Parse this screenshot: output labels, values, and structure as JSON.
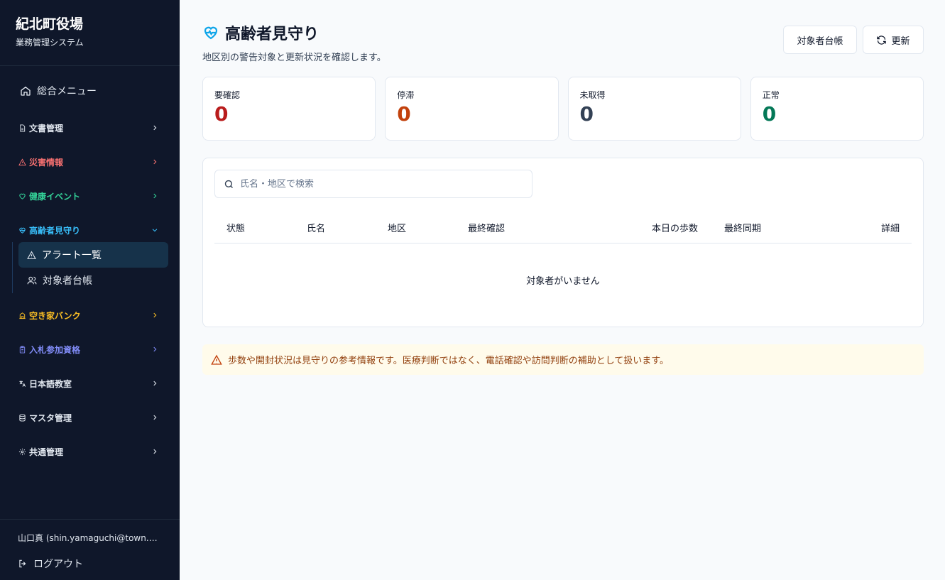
{
  "brand": {
    "name": "紀北町役場",
    "subtitle": "業務管理システム"
  },
  "sidebar": {
    "home_label": "総合メニュー",
    "items": [
      {
        "label": "文書管理",
        "color": "#e2e8f0",
        "icon": "document-icon"
      },
      {
        "label": "災害情報",
        "color": "#f87171",
        "icon": "warning-triangle-icon"
      },
      {
        "label": "健康イベント",
        "color": "#34d399",
        "icon": "heart-icon"
      },
      {
        "label": "高齢者見守り",
        "color": "#38bdf8",
        "icon": "heart-pulse-icon"
      },
      {
        "label": "空き家バンク",
        "color": "#fbbf24",
        "icon": "building-icon"
      },
      {
        "label": "入札参加資格",
        "color": "#818cf8",
        "icon": "clipboard-icon"
      },
      {
        "label": "日本語教室",
        "color": "#e2e8f0",
        "icon": "language-icon"
      },
      {
        "label": "マスタ管理",
        "color": "#e2e8f0",
        "icon": "database-icon"
      },
      {
        "label": "共通管理",
        "color": "#e2e8f0",
        "icon": "gear-icon"
      }
    ],
    "sub_items": [
      {
        "label": "アラート一覧",
        "icon": "warning-triangle-icon"
      },
      {
        "label": "対象者台帳",
        "icon": "users-icon"
      }
    ],
    "user": "山口真 (shin.yamaguchi@town.mi...",
    "logout_label": "ログアウト"
  },
  "page": {
    "title": "高齢者見守り",
    "subtitle": "地区別の警告対象と更新状況を確認します。",
    "accent": "#0ea5e9"
  },
  "toolbar": {
    "registry_label": "対象者台帳",
    "refresh_label": "更新"
  },
  "cards": [
    {
      "label": "要確認",
      "value": "0",
      "color": "#b91c1c"
    },
    {
      "label": "停滞",
      "value": "0",
      "color": "#c2410c"
    },
    {
      "label": "未取得",
      "value": "0",
      "color": "#334155"
    },
    {
      "label": "正常",
      "value": "0",
      "color": "#047857"
    }
  ],
  "search": {
    "placeholder": "氏名・地区で検索",
    "value": ""
  },
  "table": {
    "headers": [
      "状態",
      "氏名",
      "地区",
      "最終確認",
      "本日の歩数",
      "最終同期",
      "詳細"
    ],
    "empty_text": "対象者がいません"
  },
  "notice": {
    "text": "歩数や開封状況は見守りの参考情報です。医療判断ではなく、電話確認や訪問判断の補助として扱います。"
  }
}
